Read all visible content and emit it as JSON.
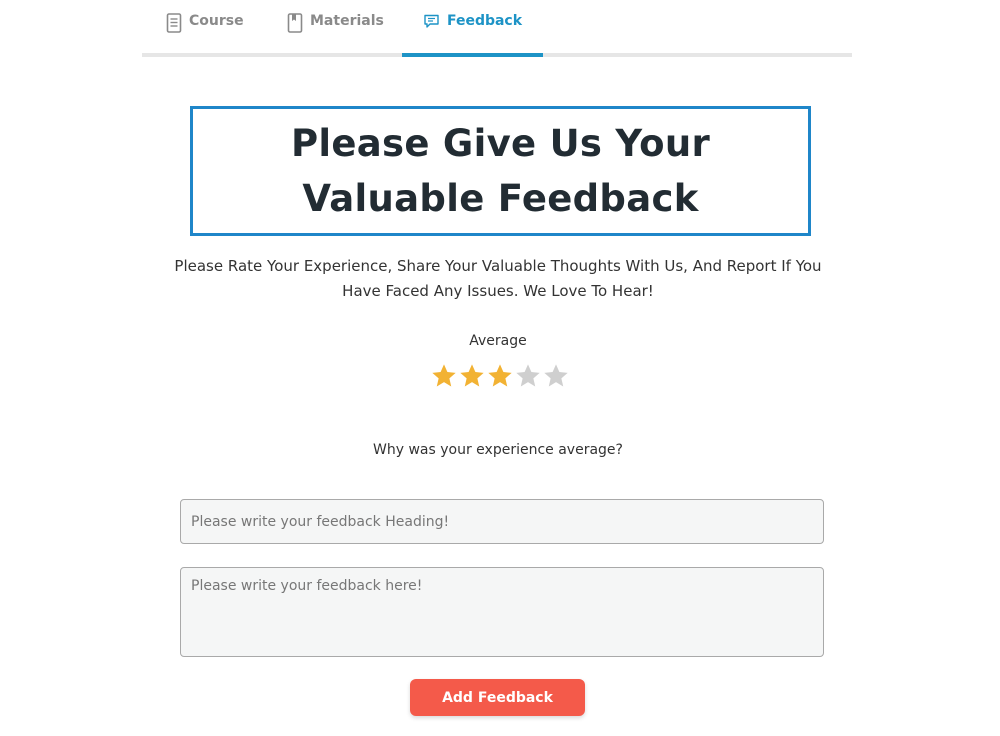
{
  "tabs": [
    {
      "label": "Course",
      "icon": "document-icon",
      "active": false
    },
    {
      "label": "Materials",
      "icon": "bookmark-book-icon",
      "active": false
    },
    {
      "label": "Feedback",
      "icon": "chat-bubble-icon",
      "active": true
    }
  ],
  "colors": {
    "accent": "#1d93c6",
    "title_border": "#1f86c9",
    "button": "#f45a4a",
    "star_filled": "#f2b233",
    "star_empty": "#cfcfcf"
  },
  "title": "Please Give Us Your Valuable Feedback",
  "subtitle": "Please Rate Your Experience, Share Your Valuable Thoughts With Us, And Report If You Have Faced Any Issues. We Love To Hear!",
  "rating": {
    "label": "Average",
    "value": 3,
    "max": 5
  },
  "question": "Why was your experience average?",
  "form": {
    "heading_placeholder": "Please write your feedback Heading!",
    "heading_value": "",
    "body_placeholder": "Please write your feedback here!",
    "body_value": "",
    "submit_label": "Add Feedback"
  }
}
